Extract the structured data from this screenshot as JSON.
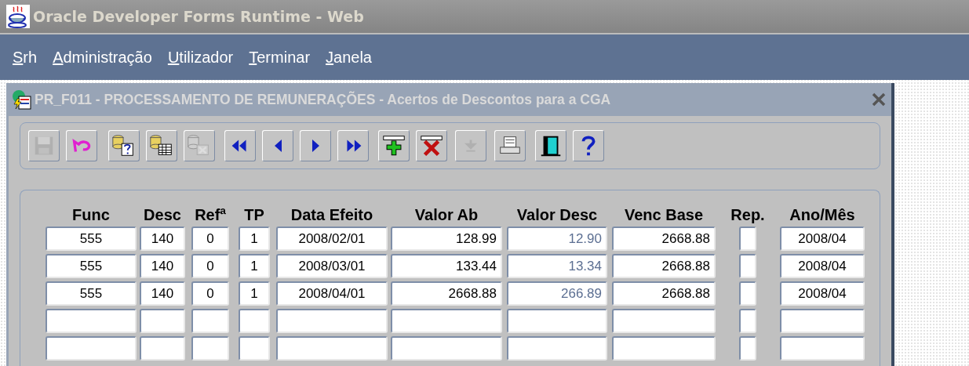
{
  "window": {
    "title": "Oracle Developer Forms Runtime - Web"
  },
  "menu": [
    {
      "label": "Srh"
    },
    {
      "label": "Administração"
    },
    {
      "label": "Utilizador"
    },
    {
      "label": "Terminar"
    },
    {
      "label": "Janela"
    }
  ],
  "form": {
    "title": "PR_F011 - PROCESSAMENTO DE REMUNERAÇÕES - Acertos de Descontos para a CGA",
    "toolbar": [
      {
        "kind": "save",
        "disabled": true
      },
      {
        "kind": "undo",
        "disabled": false
      },
      {
        "kind": "query",
        "disabled": false
      },
      {
        "kind": "execute",
        "disabled": false
      },
      {
        "kind": "cancel",
        "disabled": true
      },
      {
        "kind": "first",
        "disabled": false
      },
      {
        "kind": "prev",
        "disabled": false
      },
      {
        "kind": "next",
        "disabled": false
      },
      {
        "kind": "last",
        "disabled": false
      },
      {
        "kind": "insert",
        "disabled": false
      },
      {
        "kind": "delete",
        "disabled": false
      },
      {
        "kind": "down",
        "disabled": true
      },
      {
        "kind": "print",
        "disabled": false
      },
      {
        "kind": "exit",
        "disabled": false
      },
      {
        "kind": "help",
        "disabled": false
      }
    ],
    "table": {
      "columns": [
        {
          "label": "Func",
          "kind": "center"
        },
        {
          "label": "Desc",
          "kind": "left"
        },
        {
          "label": "Refª",
          "kind": "center"
        },
        {
          "label": "TP",
          "kind": "left"
        },
        {
          "label": "Data Efeito",
          "kind": "left"
        },
        {
          "label": "Valor Ab",
          "kind": "right"
        },
        {
          "label": "Valor Desc",
          "kind": "display"
        },
        {
          "label": "Venc Base",
          "kind": "right"
        },
        {
          "label": "Rep.",
          "kind": "check"
        },
        {
          "label": "Ano/Mês",
          "kind": "left"
        }
      ],
      "rows": [
        {
          "cells": [
            "555",
            "140",
            "0",
            "1",
            "2008/02/01",
            "128.99",
            "12.90",
            "2668.88",
            false,
            "2008/04"
          ]
        },
        {
          "cells": [
            "555",
            "140",
            "0",
            "1",
            "2008/03/01",
            "133.44",
            "13.34",
            "2668.88",
            false,
            "2008/04"
          ]
        },
        {
          "cells": [
            "555",
            "140",
            "0",
            "1",
            "2008/04/01",
            "2668.88",
            "266.89",
            "2668.88",
            false,
            "2008/04"
          ]
        },
        {
          "cells": [
            null,
            null,
            null,
            null,
            null,
            null,
            null,
            null,
            false,
            null
          ]
        },
        {
          "cells": [
            null,
            null,
            null,
            null,
            null,
            null,
            null,
            null,
            false,
            null
          ]
        }
      ]
    }
  }
}
